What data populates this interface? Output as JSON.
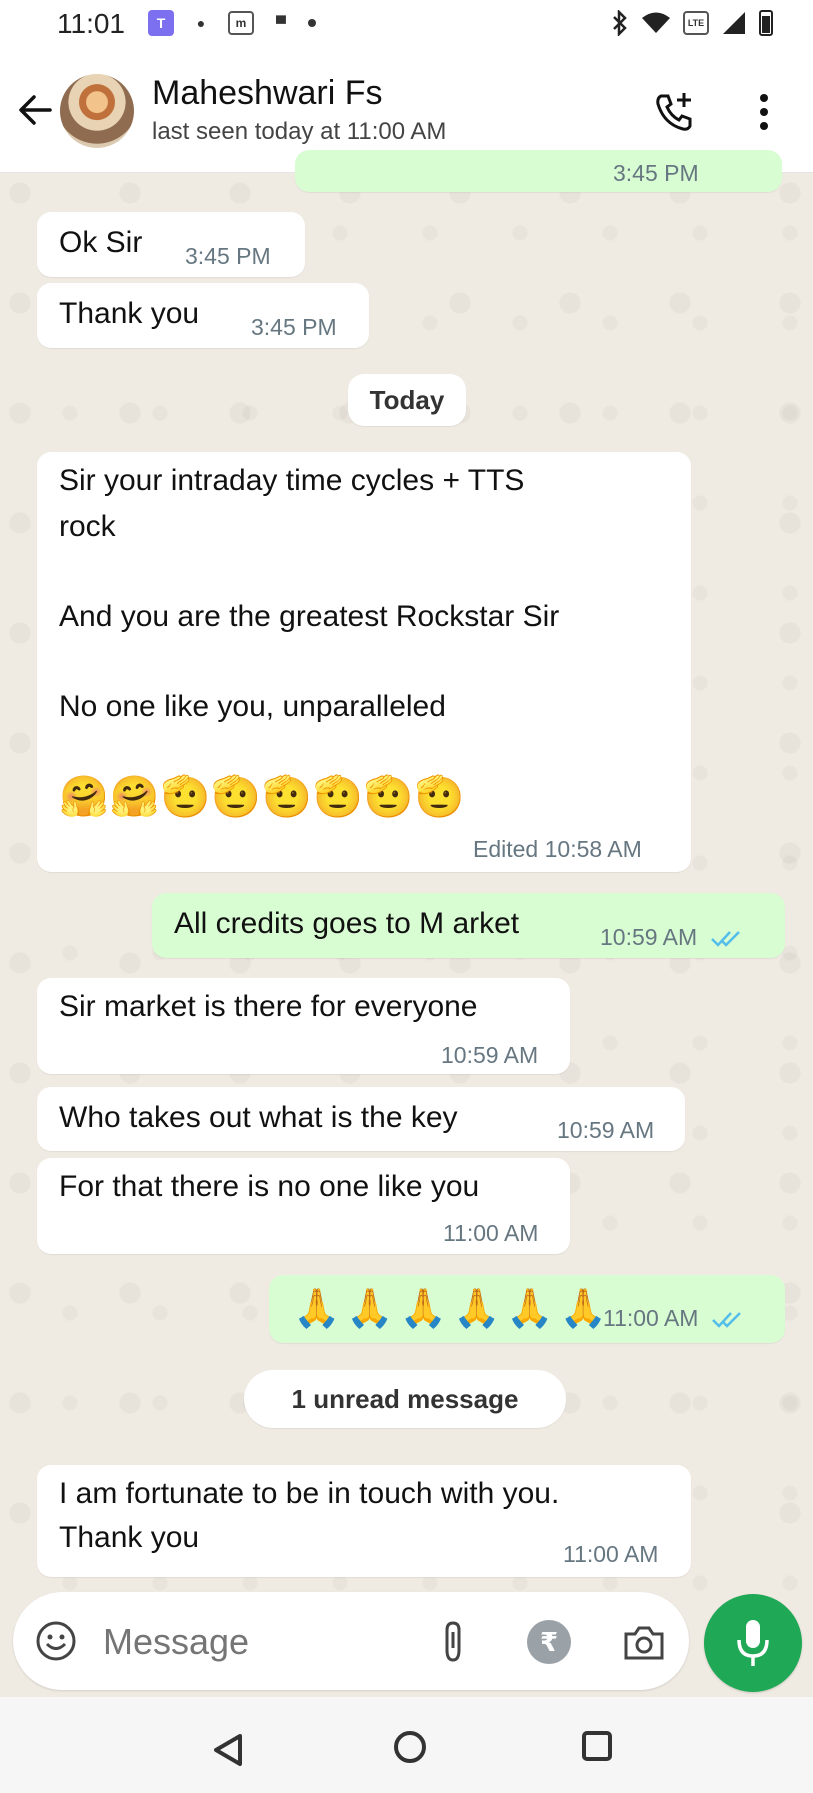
{
  "status_bar": {
    "time": "11:01",
    "icons": [
      "app-icon",
      "brand-icon",
      "messages-icon",
      "notification-icon",
      "dot-icon",
      "bluetooth-icon",
      "wifi-icon",
      "volte-icon",
      "signal-icon",
      "battery-icon"
    ]
  },
  "header": {
    "contact_name": "Maheshwari Fs",
    "last_seen": "last seen today at 11:00 AM"
  },
  "messages": [
    {
      "direction": "in",
      "text": "Ok Sir",
      "time": "3:45 PM"
    },
    {
      "direction": "in",
      "text": "Thank you",
      "time": "3:45 PM"
    },
    {
      "direction": "in",
      "lines": [
        "Sir your intraday time cycles + TTS",
        "rock",
        "And you are the greatest Rockstar Sir",
        "No one like you, unparalleled"
      ],
      "emojis": "🤗🤗🫡🫡🫡🫡🫡🫡",
      "time": "Edited 10:58 AM"
    },
    {
      "direction": "out",
      "text": "All credits goes to M arket",
      "time": "10:59 AM",
      "status": "read"
    },
    {
      "direction": "in",
      "text": "Sir market is there for everyone",
      "time": "10:59 AM"
    },
    {
      "direction": "in",
      "text": "Who takes out what is the key",
      "time": "10:59 AM"
    },
    {
      "direction": "in",
      "text": "For that there is no one like you",
      "time": "11:00 AM"
    },
    {
      "direction": "out",
      "text": "🙏🙏🙏🙏🙏🙏",
      "time": "11:00 AM",
      "status": "read"
    },
    {
      "direction": "in",
      "lines": [
        "I am fortunate to be in touch with you.",
        "Thank you"
      ],
      "time": "11:00 AM"
    }
  ],
  "date_separator": "Today",
  "unread_separator": "1 unread message",
  "composer": {
    "placeholder": "Message",
    "rupee_symbol": "₹"
  },
  "colors": {
    "outgoing_bubble": "#d9fdd3",
    "incoming_bubble": "#ffffff",
    "mic_button": "#1fa855",
    "read_ticks": "#53bdeb"
  }
}
